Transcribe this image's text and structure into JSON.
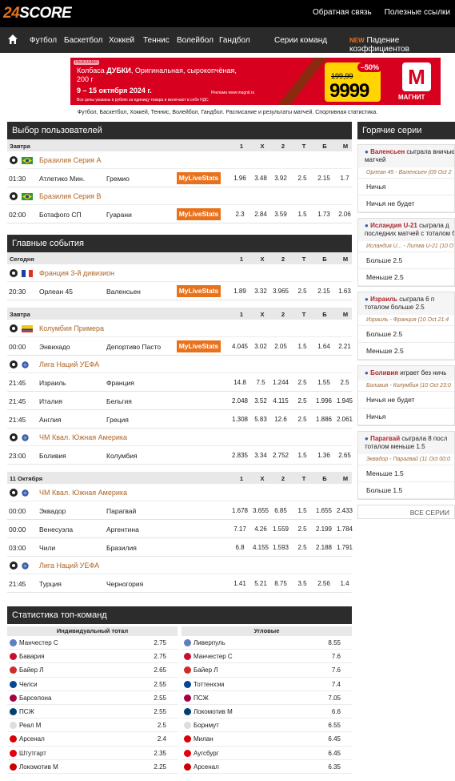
{
  "header": {
    "logo_num": "24",
    "logo_text": "SCORE",
    "link1": "Обратная связь",
    "link2": "Полезные ссылки"
  },
  "nav": {
    "items": [
      "Футбол",
      "Баскетбол",
      "Хоккей",
      "Теннис",
      "Волейбол",
      "Гандбол"
    ],
    "series": "Серии команд",
    "new_tag": "NEW",
    "drop": "Падение коэффициентов"
  },
  "banner": {
    "ad_tag": "РЕКЛАМА",
    "line1a": "Колбаса ",
    "line1b": "ДУБКИ",
    "line1c": ", Оригинальная, сырокопчёная,",
    "line2": "200 г",
    "dates": "9 – 15 октября 2024 г.",
    "note": "Все цены указаны в рублях за единицу товара и включают в себя НДС",
    "advert": "Реклама www.magnit.ru",
    "discount": "–50%",
    "old_price": "199,99",
    "new_price": "9999",
    "brand": "МАГНИТ",
    "logo_letter": "М"
  },
  "tagline": "Футбол, Баскетбол, Хоккей, Теннис, Волейбол, Гандбол. Расписание и результаты матчей. Спортивная статистика.",
  "cols": [
    "1",
    "X",
    "2",
    "T",
    "Б",
    "М"
  ],
  "user_choice": {
    "title": "Выбор пользователей",
    "date": "Завтра",
    "groups": [
      {
        "league": "Бразилия Серия А",
        "matches": [
          {
            "time": "01:30",
            "home": "Атлетико Мин.",
            "away": "Гремио",
            "mls": "MyLiveStats",
            "odds": [
              "1.96",
              "3.48",
              "3.92",
              "2.5",
              "2.15",
              "1.7"
            ]
          }
        ]
      },
      {
        "league": "Бразилия Серия В",
        "matches": [
          {
            "time": "02:00",
            "home": "Ботафого СП",
            "away": "Гуарани",
            "mls": "MyLiveStats",
            "odds": [
              "2.3",
              "2.84",
              "3.59",
              "1.5",
              "1.73",
              "2.06"
            ]
          }
        ]
      }
    ]
  },
  "main_events": {
    "title": "Главные события",
    "blocks": [
      {
        "date": "Сегодня",
        "groups": [
          {
            "league": "Франция 3-й дивизион",
            "matches": [
              {
                "time": "20:30",
                "home": "Орлеан 45",
                "away": "Валенсьен",
                "mls": "MyLiveStats",
                "odds": [
                  "1.89",
                  "3.32",
                  "3.965",
                  "2.5",
                  "2.15",
                  "1.63"
                ]
              }
            ]
          }
        ]
      },
      {
        "date": "Завтра",
        "groups": [
          {
            "league": "Колумбия Примера",
            "matches": [
              {
                "time": "00:00",
                "home": "Энвихадо",
                "away": "Депортиво Пасто",
                "mls": "MyLiveStats",
                "odds": [
                  "4.045",
                  "3.02",
                  "2.05",
                  "1.5",
                  "1.64",
                  "2.21"
                ]
              }
            ]
          },
          {
            "league": "Лига Наций УЕФА",
            "matches": [
              {
                "time": "21:45",
                "home": "Израиль",
                "away": "Франция",
                "mls": "",
                "odds": [
                  "14.8",
                  "7.5",
                  "1.244",
                  "2.5",
                  "1.55",
                  "2.5"
                ]
              },
              {
                "time": "21:45",
                "home": "Италия",
                "away": "Бельгия",
                "mls": "",
                "odds": [
                  "2.048",
                  "3.52",
                  "4.115",
                  "2.5",
                  "1.996",
                  "1.945"
                ]
              },
              {
                "time": "21:45",
                "home": "Англия",
                "away": "Греция",
                "mls": "",
                "odds": [
                  "1.308",
                  "5.83",
                  "12.6",
                  "2.5",
                  "1.886",
                  "2.061"
                ]
              }
            ]
          },
          {
            "league": "ЧМ Квал. Южная Америка",
            "matches": [
              {
                "time": "23:00",
                "home": "Боливия",
                "away": "Колумбия",
                "mls": "",
                "odds": [
                  "2.835",
                  "3.34",
                  "2.752",
                  "1.5",
                  "1.36",
                  "2.65"
                ]
              }
            ]
          }
        ]
      },
      {
        "date": "11 Октября",
        "groups": [
          {
            "league": "ЧМ Квал. Южная Америка",
            "matches": [
              {
                "time": "00:00",
                "home": "Эквадор",
                "away": "Парагвай",
                "mls": "",
                "odds": [
                  "1.678",
                  "3.655",
                  "6.85",
                  "1.5",
                  "1.655",
                  "2.433"
                ]
              },
              {
                "time": "00:00",
                "home": "Венесуэла",
                "away": "Аргентина",
                "mls": "",
                "odds": [
                  "7.17",
                  "4.26",
                  "1.559",
                  "2.5",
                  "2.199",
                  "1.784"
                ]
              },
              {
                "time": "03:00",
                "home": "Чили",
                "away": "Бразилия",
                "mls": "",
                "odds": [
                  "6.8",
                  "4.155",
                  "1.593",
                  "2.5",
                  "2.188",
                  "1.791"
                ]
              }
            ]
          },
          {
            "league": "Лига Наций УЕФА",
            "matches": [
              {
                "time": "21:45",
                "home": "Турция",
                "away": "Черногория",
                "mls": "",
                "odds": [
                  "1.41",
                  "5.21",
                  "8.75",
                  "3.5",
                  "2.56",
                  "1.4"
                ]
              }
            ]
          }
        ]
      }
    ]
  },
  "hot": {
    "title": "Горячие серии",
    "cards": [
      {
        "team": "Валенсьен",
        "text": " сыграла вничью",
        "text2": "матчей",
        "sub": "Орлеан 45 - Валенсьен (09 Oct 2",
        "opts": [
          "Ничья",
          "Ничья не будет"
        ]
      },
      {
        "team": "Исландия U-21",
        "text": " сыграла д",
        "text2": "последних матчей с тоталом бо",
        "sub": "Исландия U... - Литва U-21 (10 O",
        "opts": [
          "Больше 2.5",
          "Меньше 2.5"
        ]
      },
      {
        "team": "Израиль",
        "text": " сыграла 6 п",
        "text2": "тоталом больше 2.5",
        "sub": "Израиль - Франция (10 Oct 21:4",
        "opts": [
          "Больше 2.5",
          "Меньше 2.5"
        ]
      },
      {
        "team": "Боливия",
        "text": " играет без ничь",
        "text2": "",
        "sub": "Боливия - Колумбия (10 Oct 23:0",
        "opts": [
          "Ничья не будет",
          "Ничья"
        ]
      },
      {
        "team": "Парагвай",
        "text": " сыграла 8 посл",
        "text2": "тоталом меньше 1.5",
        "sub": "Эквадор - Парагвай (11 Oct 00:0",
        "opts": [
          "Меньше 1.5",
          "Больше 1.5"
        ]
      }
    ],
    "all": "ВСЕ СЕРИИ"
  },
  "stats": {
    "title": "Статистика топ-команд",
    "left": {
      "title": "Индивидуальный тотал",
      "rows": [
        [
          "Манчестер С",
          "2.75"
        ],
        [
          "Бавария",
          "2.75"
        ],
        [
          "Байер Л",
          "2.65"
        ],
        [
          "Челси",
          "2.55"
        ],
        [
          "Барселона",
          "2.55"
        ],
        [
          "ПСЖ",
          "2.55"
        ],
        [
          "Реал М",
          "2.5"
        ],
        [
          "Арсенал",
          "2.4"
        ],
        [
          "Штутгарт",
          "2.35"
        ],
        [
          "Локомотив М",
          "2.25"
        ]
      ]
    },
    "right": {
      "title": "Угловые",
      "rows": [
        [
          "Ливерпуль",
          "8.55"
        ],
        [
          "Манчестер С",
          "7.6"
        ],
        [
          "Байер Л",
          "7.6"
        ],
        [
          "Тоттенхэм",
          "7.4"
        ],
        [
          "ПСЖ",
          "7.05"
        ],
        [
          "Локомотив М",
          "6.6"
        ],
        [
          "Борнмут",
          "6.55"
        ],
        [
          "Милан",
          "6.45"
        ],
        [
          "Аугсбург",
          "6.45"
        ],
        [
          "Арсенал",
          "6.35"
        ]
      ]
    }
  },
  "colors": {
    "accent": "#e8721c",
    "dark": "#2c2c2c",
    "league": "#b06524",
    "hot_team": "#b0262d"
  }
}
